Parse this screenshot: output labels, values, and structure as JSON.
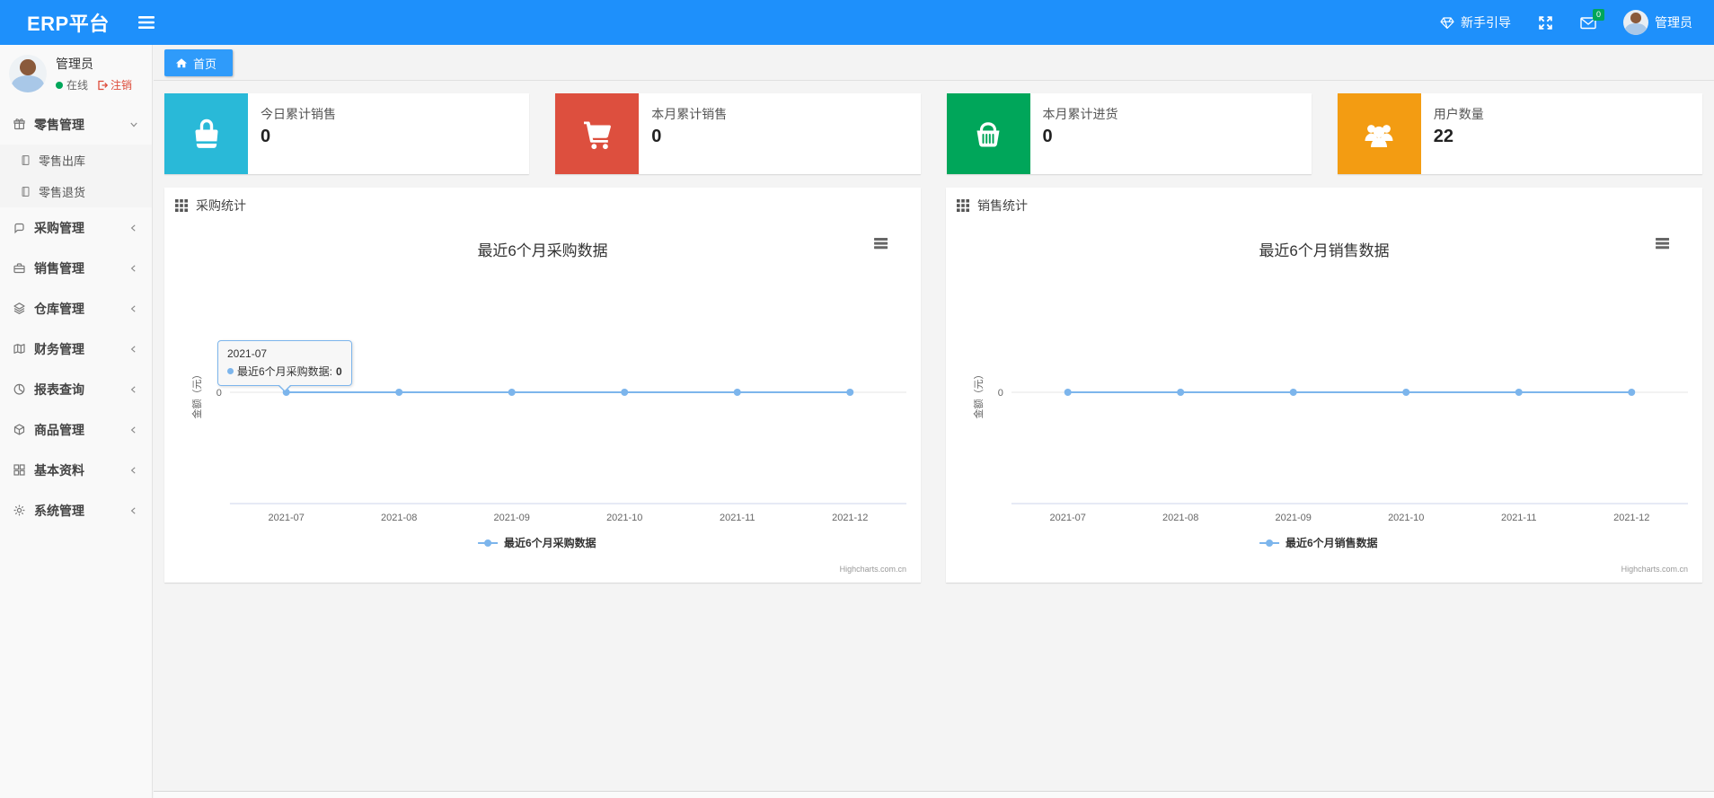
{
  "navbar": {
    "brand": "ERP平台",
    "guide_label": "新手引导",
    "mail_badge": "0",
    "user_name": "管理员"
  },
  "sidebar": {
    "user": {
      "name": "管理员",
      "status": "在线",
      "logout": "注销"
    },
    "items": [
      {
        "label": "零售管理",
        "icon": "gift-icon",
        "expanded": true,
        "children": [
          {
            "label": "零售出库"
          },
          {
            "label": "零售退货"
          }
        ]
      },
      {
        "label": "采购管理",
        "icon": "chat-icon"
      },
      {
        "label": "销售管理",
        "icon": "briefcase-icon"
      },
      {
        "label": "仓库管理",
        "icon": "layers-icon"
      },
      {
        "label": "财务管理",
        "icon": "map-icon"
      },
      {
        "label": "报表查询",
        "icon": "pie-chart-icon"
      },
      {
        "label": "商品管理",
        "icon": "box-icon"
      },
      {
        "label": "基本资料",
        "icon": "grid-icon"
      },
      {
        "label": "系统管理",
        "icon": "gear-icon"
      }
    ]
  },
  "tabs": {
    "home": "首页"
  },
  "stat_cards": [
    {
      "label": "今日累计销售",
      "value": "0",
      "color": "#29B9D8",
      "icon": "shopping-bag-icon"
    },
    {
      "label": "本月累计销售",
      "value": "0",
      "color": "#DD4F3E",
      "icon": "cart-icon"
    },
    {
      "label": "本月累计进货",
      "value": "0",
      "color": "#00A65A",
      "icon": "basket-icon"
    },
    {
      "label": "用户数量",
      "value": "22",
      "color": "#F39C12",
      "icon": "users-icon"
    }
  ],
  "panels": [
    {
      "title": "采购统计"
    },
    {
      "title": "销售统计"
    }
  ],
  "chart_data": [
    {
      "type": "line",
      "title": "最近6个月采购数据",
      "categories": [
        "2021-07",
        "2021-08",
        "2021-09",
        "2021-10",
        "2021-11",
        "2021-12"
      ],
      "series": [
        {
          "name": "最近6个月采购数据",
          "values": [
            0,
            0,
            0,
            0,
            0,
            0
          ],
          "color": "#7CB5EC"
        }
      ],
      "ylabel": "金额（元）",
      "yticks": [
        "0"
      ],
      "legend_position": "bottom",
      "grid": "zero-line-only",
      "credits": "Highcharts.com.cn",
      "tooltip": {
        "visible": true,
        "header": "2021-07",
        "series_label": "最近6个月采购数据:",
        "value": "0"
      }
    },
    {
      "type": "line",
      "title": "最近6个月销售数据",
      "categories": [
        "2021-07",
        "2021-08",
        "2021-09",
        "2021-10",
        "2021-11",
        "2021-12"
      ],
      "series": [
        {
          "name": "最近6个月销售数据",
          "values": [
            0,
            0,
            0,
            0,
            0,
            0
          ],
          "color": "#7CB5EC"
        }
      ],
      "ylabel": "金额（元）",
      "yticks": [
        "0"
      ],
      "legend_position": "bottom",
      "grid": "zero-line-only",
      "credits": "Highcharts.com.cn",
      "tooltip": {
        "visible": false
      }
    }
  ],
  "colors": {
    "navbar_blue": "#1E90FB",
    "tab_blue": "#2F9BFA",
    "badge_green": "#00A65A",
    "chart_line_blue": "#7CB5EC",
    "logout_red": "#DD4B39"
  }
}
